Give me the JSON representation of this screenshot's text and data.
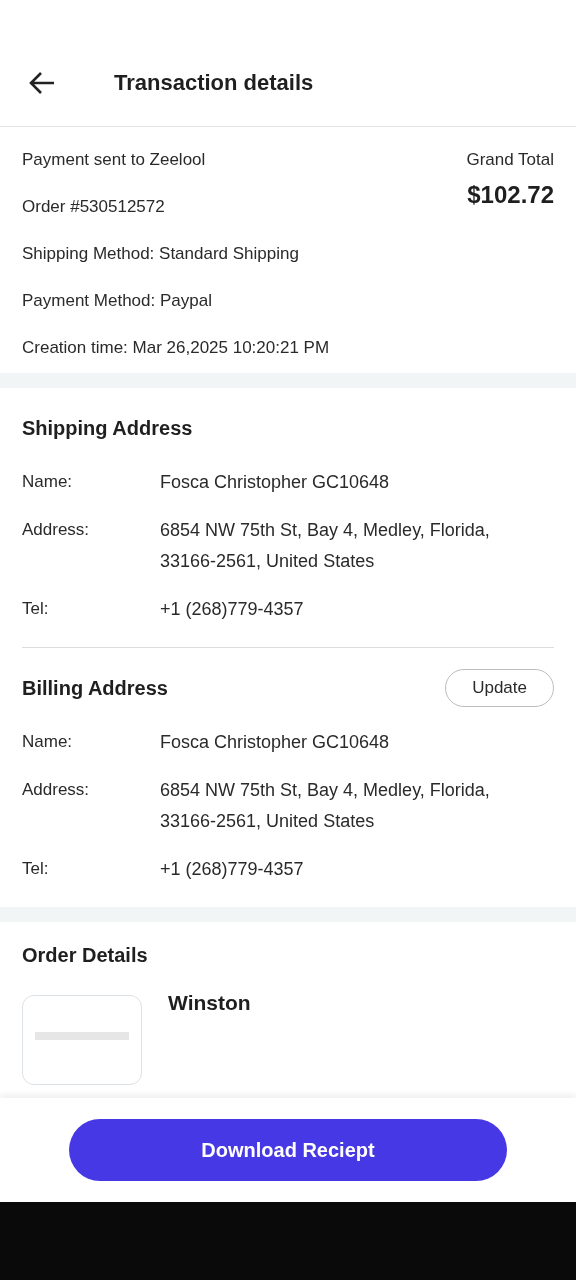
{
  "header": {
    "title": "Transaction details"
  },
  "summary": {
    "lines": [
      "Payment sent to Zeelool",
      "Order #530512572",
      "Shipping Method: Standard Shipping",
      "Payment Method: Paypal",
      "Creation time: Mar 26,2025 10:20:21 PM"
    ],
    "total_label": "Grand Total",
    "total": "$102.72"
  },
  "addresses": [
    {
      "title": "Shipping Address",
      "fields": [
        {
          "label": "Name:",
          "value": "Fosca Christopher GC10648"
        },
        {
          "label": "Address:",
          "value": "6854 NW 75th St, Bay 4, Medley, Florida, 33166-2561, United States"
        },
        {
          "label": "Tel:",
          "value": "+1 (268)779-4357"
        }
      ]
    },
    {
      "title": "Billing Address",
      "action": "Update",
      "fields": [
        {
          "label": "Name:",
          "value": "Fosca Christopher GC10648"
        },
        {
          "label": "Address:",
          "value": "6854 NW 75th St, Bay 4, Medley, Florida, 33166-2561, United States"
        },
        {
          "label": "Tel:",
          "value": "+1 (268)779-4357"
        }
      ]
    }
  ],
  "order": {
    "title": "Order Details",
    "items": [
      {
        "name": "Winston"
      }
    ]
  },
  "footer": {
    "button": "Download Reciept"
  }
}
